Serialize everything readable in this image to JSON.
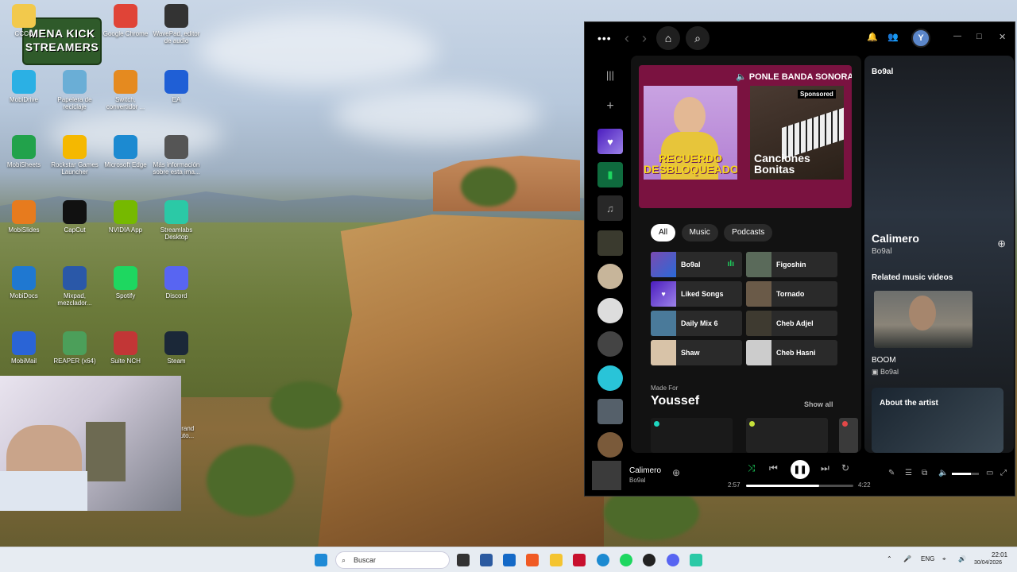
{
  "desktop": {
    "logo_text": "MENA KICK STREAMERS",
    "icons": [
      {
        "label": "CCCC",
        "color": "#f2c94c"
      },
      {
        "label": "",
        "color": "#2a5db0"
      },
      {
        "label": "Google Chrome",
        "color": "#e04437"
      },
      {
        "label": "WavePad, editor de audio",
        "color": "#333"
      },
      {
        "label": "MobiDrive",
        "color": "#2bb0e4"
      },
      {
        "label": "Papelera de reciclaje",
        "color": "#6aaed6"
      },
      {
        "label": "Switch, convertidor ...",
        "color": "#e58a1f"
      },
      {
        "label": "EA",
        "color": "#1f5fd6"
      },
      {
        "label": "MobiSheets",
        "color": "#22a24b"
      },
      {
        "label": "Rockstar Games Launcher",
        "color": "#f5b800"
      },
      {
        "label": "Microsoft Edge",
        "color": "#1c8ad1"
      },
      {
        "label": "Más información sobre esta ima...",
        "color": "#555"
      },
      {
        "label": "MobiSlides",
        "color": "#e77b1e"
      },
      {
        "label": "CapCut",
        "color": "#111"
      },
      {
        "label": "NVIDIA App",
        "color": "#76b900"
      },
      {
        "label": "Streamlabs Desktop",
        "color": "#2bc9a6"
      },
      {
        "label": "MobiDocs",
        "color": "#1f78d1"
      },
      {
        "label": "Mixpad, mezclador...",
        "color": "#2a58a8"
      },
      {
        "label": "Spotify",
        "color": "#1ed760"
      },
      {
        "label": "Discord",
        "color": "#5865f2"
      },
      {
        "label": "MobiMail",
        "color": "#2a64d6"
      },
      {
        "label": "REAPER (x64)",
        "color": "#4c9f5a"
      },
      {
        "label": "Suite NCH",
        "color": "#c23636"
      },
      {
        "label": "Steam",
        "color": "#1b2838"
      }
    ],
    "partial_label": "Grand auto..."
  },
  "spotify": {
    "nav": {
      "more": "•••",
      "back": "‹",
      "fwd": "›",
      "home": "⌂",
      "search": "⌕",
      "bell": "🔔",
      "friends": "👥",
      "avatar": "Y",
      "min": "—",
      "max": "□",
      "close": "✕"
    },
    "ad": {
      "title": "🔈 PONLE BANDA SONORA",
      "sponsored": "Sponsored",
      "card1": "RECUERDO DESBLOQUEADO",
      "card2": "Canciones Bonitas"
    },
    "filters": [
      "All",
      "Music",
      "Podcasts"
    ],
    "shortcuts": [
      {
        "name": "Bo9al",
        "playing": true
      },
      {
        "name": "Figoshin"
      },
      {
        "name": "Liked Songs"
      },
      {
        "name": "Tornado"
      },
      {
        "name": "Daily Mix 6"
      },
      {
        "name": "Cheb Adjel"
      },
      {
        "name": "Shaw"
      },
      {
        "name": "Cheb Hasni"
      }
    ],
    "made_for_label": "Made For",
    "made_for_name": "Youssef",
    "show_all": "Show all",
    "side": {
      "artist_header": "Bo9al",
      "song": "Calimero",
      "artist": "Bo9al",
      "related": "Related music videos",
      "video_title": "BOOM",
      "video_artist": "Bo9al",
      "about": "About the artist"
    },
    "player": {
      "title": "Calimero",
      "artist": "Bo9al",
      "elapsed": "2:57",
      "duration": "4:22",
      "progress": 0.68,
      "volume": 0.7
    }
  },
  "taskbar": {
    "search_placeholder": "Buscar",
    "lang": "ENG",
    "time": "22:01",
    "date": "30/04/2026"
  }
}
